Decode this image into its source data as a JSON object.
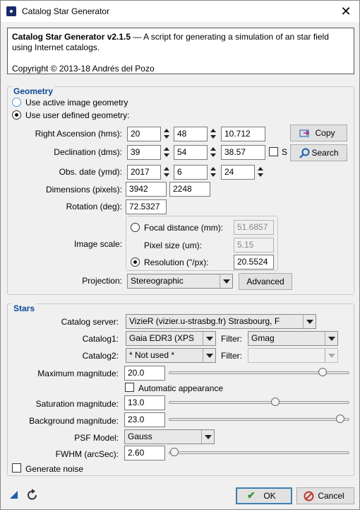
{
  "window": {
    "title": "Catalog Star Generator",
    "close": "✕"
  },
  "description": {
    "name": "Catalog Star Generator v2.1.5",
    "tagline": " — A script for generating a simulation of an star field using Internet catalogs.",
    "copyright": "Copyright © 2013-18 Andrés del Pozo"
  },
  "geometry": {
    "title": "Geometry",
    "use_active": "Use active image geometry",
    "use_user": "Use user defined geometry:",
    "ra_label": "Right Ascension (hms):",
    "ra": [
      "20",
      "48",
      "10.712"
    ],
    "dec_label": "Declination (dms):",
    "dec": [
      "39",
      "54",
      "38.57"
    ],
    "s_label": "S",
    "date_label": "Obs. date (ymd):",
    "date": [
      "2017",
      "6",
      "24"
    ],
    "dims_label": "Dimensions (pixels):",
    "dims": [
      "3942",
      "2248"
    ],
    "rotation_label": "Rotation (deg):",
    "rotation": "72.5327",
    "scale_label": "Image scale:",
    "focal_label": "Focal distance (mm):",
    "focal": "51.6857",
    "pixel_label": "Pixel size (um):",
    "pixel": "5.15",
    "resolution_label": "Resolution (\"/px):",
    "resolution": "20.5524",
    "projection_label": "Projection:",
    "projection": "Stereographic",
    "advanced": "Advanced",
    "copy": "Copy",
    "search": "Search"
  },
  "stars": {
    "title": "Stars",
    "server_label": "Catalog server:",
    "server": "VizieR (vizier.u-strasbg.fr) Strasbourg, F",
    "catalog1_label": "Catalog1:",
    "catalog1": "Gaia EDR3 (XPS",
    "filter1_label": "Filter:",
    "filter1": "Gmag",
    "catalog2_label": "Catalog2:",
    "catalog2": "* Not used *",
    "filter2_label": "Filter:",
    "filter2": "",
    "maxmag_label": "Maximum magnitude:",
    "maxmag": "20.0",
    "maxmag_level": 0.85,
    "auto_label": "Automatic appearance",
    "satmag_label": "Saturation magnitude:",
    "satmag": "13.0",
    "satmag_level": 0.59,
    "bgmag_label": "Background magnitude:",
    "bgmag": "23.0",
    "bgmag_level": 0.95,
    "psf_label": "PSF Model:",
    "psf": "Gauss",
    "fwhm_label": "FWHM (arcSec):",
    "fwhm": "2.60",
    "fwhm_level": 0.03,
    "noise_label": "Generate noise"
  },
  "footer": {
    "ok": "OK",
    "cancel": "Cancel"
  },
  "colors": {
    "group_title": "#0a4a96",
    "ok_check": "#2e9a2e",
    "cancel_icon": "#c0392b",
    "search_icon": "#1c5fb0"
  }
}
